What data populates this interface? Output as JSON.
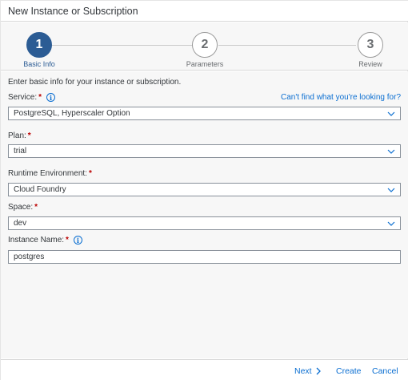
{
  "dialog": {
    "title": "New Instance or Subscription"
  },
  "wizard": {
    "steps": [
      {
        "number": "1",
        "label": "Basic Info",
        "active": true
      },
      {
        "number": "2",
        "label": "Parameters",
        "active": false
      },
      {
        "number": "3",
        "label": "Review",
        "active": false
      }
    ]
  },
  "form": {
    "intro": "Enter basic info for your instance or subscription.",
    "help_link": "Can't find what you're looking for?",
    "service": {
      "label": "Service:",
      "value": "PostgreSQL, Hyperscaler Option"
    },
    "plan": {
      "label": "Plan:",
      "value": "trial"
    },
    "runtime": {
      "label": "Runtime Environment:",
      "value": "Cloud Foundry"
    },
    "space": {
      "label": "Space:",
      "value": "dev"
    },
    "instance_name": {
      "label": "Instance Name:",
      "value": "postgres"
    }
  },
  "footer": {
    "next_label": "Next",
    "create_label": "Create",
    "cancel_label": "Cancel"
  },
  "colors": {
    "accent": "#0a6ed1",
    "active_step": "#2c5c94",
    "required": "#bb0000"
  }
}
